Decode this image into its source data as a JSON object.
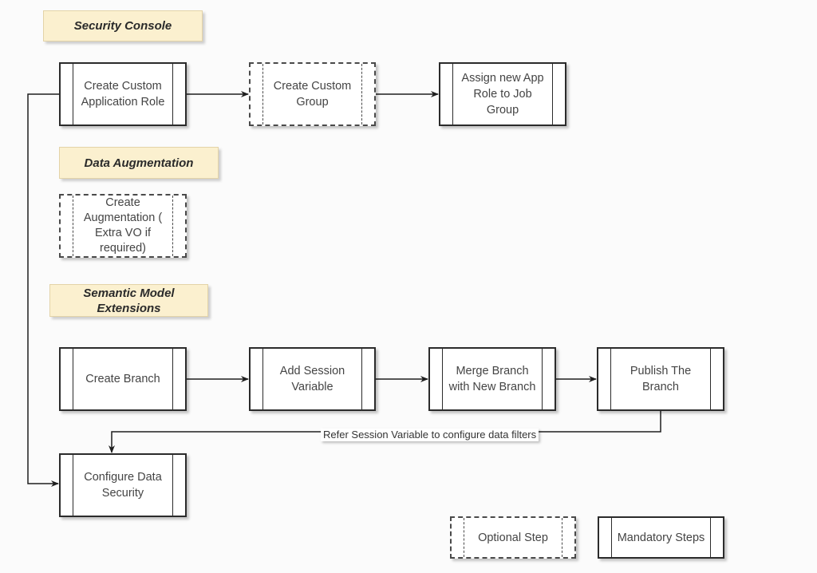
{
  "sections": {
    "security_console": "Security Console",
    "data_augmentation": "Data Augmentation",
    "semantic_model_extensions": "Semantic Model\nExtensions"
  },
  "steps": {
    "create_custom_app_role": {
      "label": "Create Custom\nApplication Role",
      "type": "mandatory"
    },
    "create_custom_group": {
      "label": "Create Custom\nGroup",
      "type": "optional"
    },
    "assign_app_role": {
      "label": "Assign new App\nRole to Job\nGroup",
      "type": "mandatory"
    },
    "create_augmentation": {
      "label": "Create\nAugmentation (\nExtra VO if\nrequired)",
      "type": "optional"
    },
    "create_branch": {
      "label": "Create Branch",
      "type": "mandatory"
    },
    "add_session_variable": {
      "label": "Add Session\nVariable",
      "type": "mandatory"
    },
    "merge_branch": {
      "label": "Merge Branch\nwith New Branch",
      "type": "mandatory"
    },
    "publish_branch": {
      "label": "Publish The\nBranch",
      "type": "mandatory"
    },
    "configure_data_security": {
      "label": "Configure Data\nSecurity",
      "type": "mandatory"
    }
  },
  "edges": {
    "feedback_label": "Refer Session Variable to configure data filters"
  },
  "legend": {
    "optional": "Optional Step",
    "mandatory": "Mandatory Steps"
  },
  "colors": {
    "section_fill": "#fbf0cf",
    "line": "#1e1e1e",
    "background": "#fbfbfb"
  }
}
